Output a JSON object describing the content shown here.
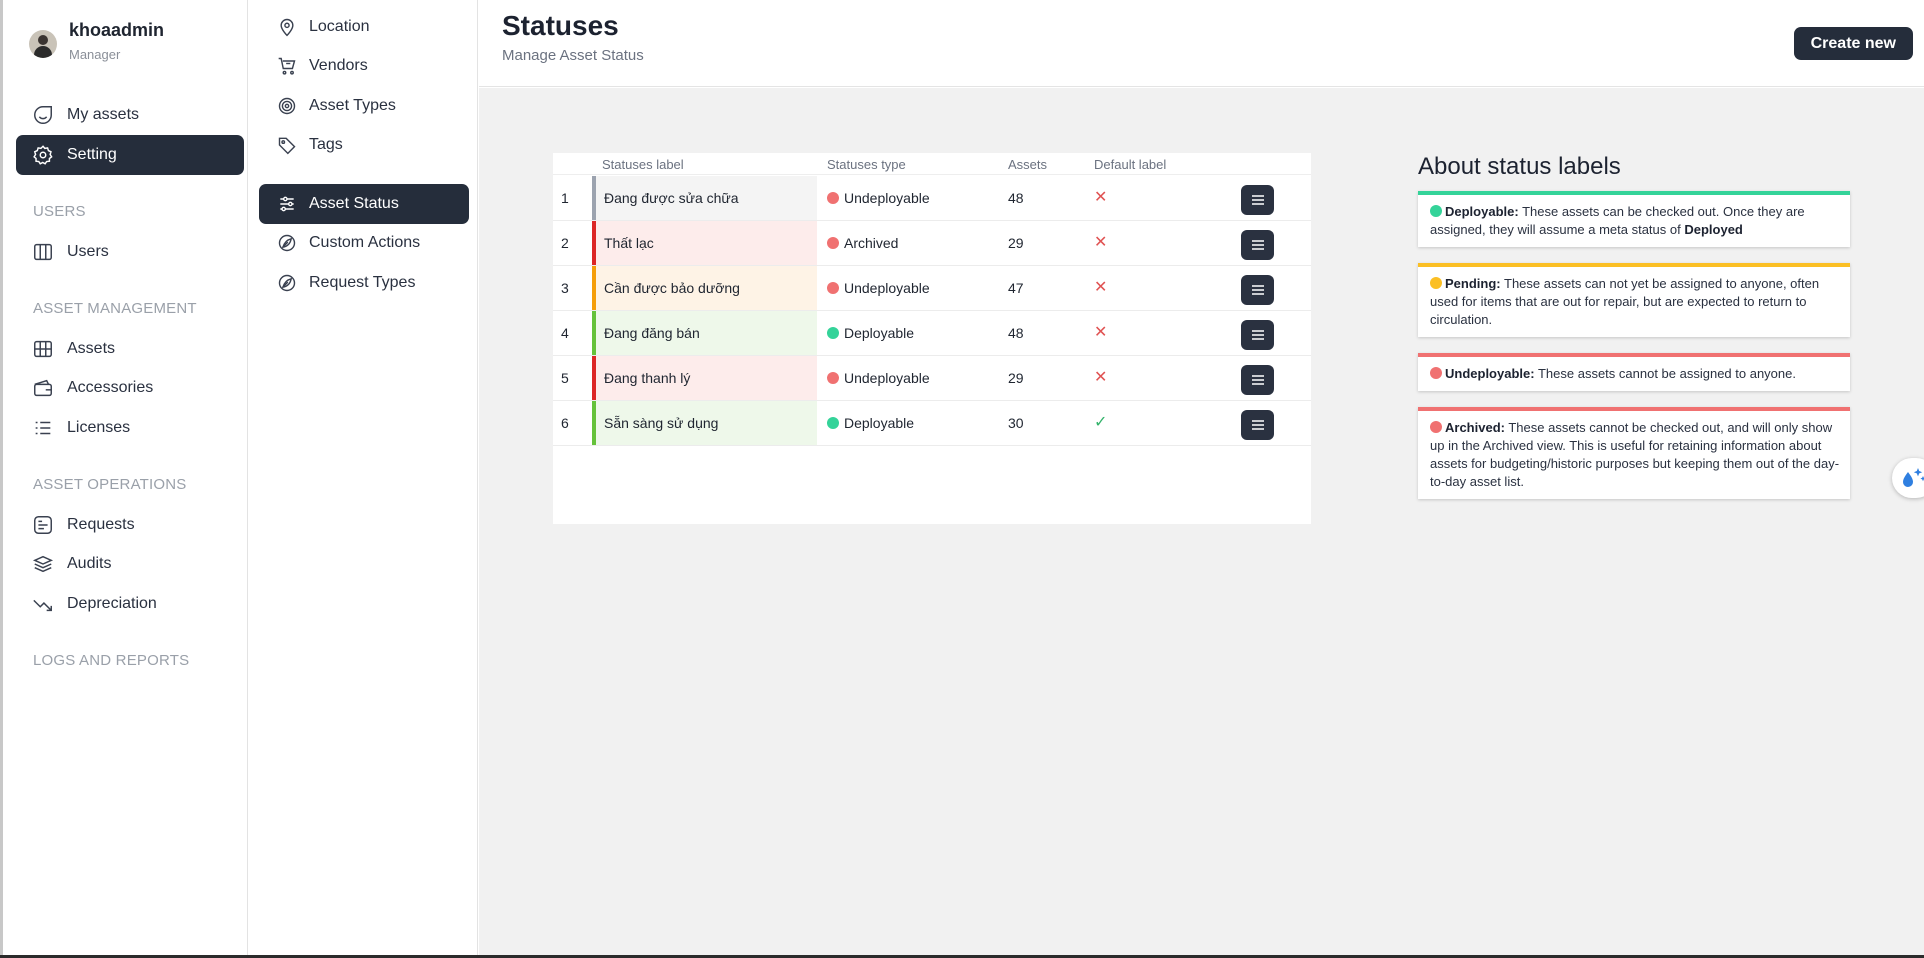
{
  "profile": {
    "name": "khoaadmin",
    "role": "Manager"
  },
  "sidebar": {
    "items": [
      {
        "label": "My assets",
        "icon": "my-assets-icon"
      },
      {
        "label": "Setting",
        "icon": "gear-icon",
        "active": true
      }
    ],
    "sections": [
      {
        "title": "USERS",
        "items": [
          {
            "label": "Users",
            "icon": "users-icon"
          }
        ]
      },
      {
        "title": "ASSET MANAGEMENT",
        "items": [
          {
            "label": "Assets",
            "icon": "assets-icon"
          },
          {
            "label": "Accessories",
            "icon": "accessories-icon"
          },
          {
            "label": "Licenses",
            "icon": "licenses-icon"
          }
        ]
      },
      {
        "title": "ASSET OPERATIONS",
        "items": [
          {
            "label": "Requests",
            "icon": "requests-icon"
          },
          {
            "label": "Audits",
            "icon": "audits-icon"
          },
          {
            "label": "Depreciation",
            "icon": "depreciation-icon"
          }
        ]
      },
      {
        "title": "LOGS AND REPORTS",
        "items": []
      }
    ]
  },
  "settings_nav": {
    "items": [
      {
        "label": "Location",
        "icon": "location-icon"
      },
      {
        "label": "Vendors",
        "icon": "cart-icon"
      },
      {
        "label": "Asset Types",
        "icon": "target-icon"
      },
      {
        "label": "Tags",
        "icon": "tag-icon"
      },
      {
        "label": "Asset Status",
        "icon": "sliders-icon",
        "active": true
      },
      {
        "label": "Custom Actions",
        "icon": "leaf-icon"
      },
      {
        "label": "Request Types",
        "icon": "leaf-icon"
      }
    ]
  },
  "header": {
    "title": "Statuses",
    "subtitle": "Manage Asset Status",
    "create_label": "Create new"
  },
  "table": {
    "columns": [
      "Statuses label",
      "Statuses type",
      "Assets",
      "Default label"
    ],
    "rows": [
      {
        "num": "1",
        "label": "Đang được sửa chữa",
        "type": "Undeployable",
        "assets": "48",
        "default": "✕",
        "accent": "#9ca3af",
        "bg": "#f4f4f4",
        "type_color": "#f07171",
        "default_color": "#e05252"
      },
      {
        "num": "2",
        "label": "Thất lạc",
        "type": "Archived",
        "assets": "29",
        "default": "✕",
        "accent": "#dc2626",
        "bg": "#fdeceb",
        "type_color": "#f07171",
        "default_color": "#e05252"
      },
      {
        "num": "3",
        "label": "Cần được bảo dưỡng",
        "type": "Undeployable",
        "assets": "47",
        "default": "✕",
        "accent": "#f59e0b",
        "bg": "#fef3e6",
        "type_color": "#f07171",
        "default_color": "#e05252"
      },
      {
        "num": "4",
        "label": "Đang đăng bán",
        "type": "Deployable",
        "assets": "48",
        "default": "✕",
        "accent": "#65c23a",
        "bg": "#eef8ea",
        "type_color": "#34d399",
        "default_color": "#e05252"
      },
      {
        "num": "5",
        "label": "Đang thanh lý",
        "type": "Undeployable",
        "assets": "29",
        "default": "✕",
        "accent": "#dc2626",
        "bg": "#fdeceb",
        "type_color": "#f07171",
        "default_color": "#e05252"
      },
      {
        "num": "6",
        "label": "Sẵn sàng sử dụng",
        "type": "Deployable",
        "assets": "30",
        "default": "✓",
        "accent": "#65c23a",
        "bg": "#eef8ea",
        "type_color": "#34d399",
        "default_color": "#34b36b"
      }
    ]
  },
  "about": {
    "title": "About status labels",
    "cards": [
      {
        "name": "Deployable:",
        "color": "#34d399",
        "text": "These assets can be checked out. Once they are assigned, they will assume a meta status of ",
        "bold_tail": "Deployed"
      },
      {
        "name": "Pending:",
        "color": "#fbbf24",
        "text": "These assets can not yet be assigned to anyone, often used for items that are out for repair, but are expected to return to circulation.",
        "bold_tail": ""
      },
      {
        "name": "Undeployable:",
        "color": "#f07171",
        "text": "These assets cannot be assigned to anyone.",
        "bold_tail": ""
      },
      {
        "name": "Archived:",
        "color": "#f07171",
        "text": "These assets cannot be checked out, and will only show up in the Archived view. This is useful for retaining information about assets for budgeting/historic purposes but keeping them out of the day-to-day asset list.",
        "bold_tail": ""
      }
    ]
  }
}
